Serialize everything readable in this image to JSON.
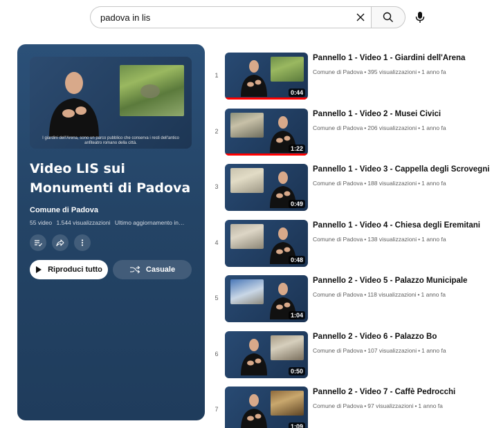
{
  "search": {
    "query": "padova in lis"
  },
  "icons": {
    "clear": "close-icon",
    "search": "search-icon",
    "mic": "microphone-icon",
    "save": "add-to-queue-icon",
    "share": "share-icon",
    "more": "more-vert-icon",
    "play": "play-icon",
    "shuffle": "shuffle-icon"
  },
  "colors": {
    "panel": "#244466",
    "progress": "#ff0000"
  },
  "playlist": {
    "thumb_caption": "I giardini dell'Arena, sono un parco pubblico che conserva i resti dell'antico anfiteatro romano della città.",
    "title": "Video LIS sui Monumenti di Padova",
    "channel": "Comune di Padova",
    "video_count": "55 video",
    "views": "1.544 visualizzazioni",
    "updated": "Ultimo aggiornamento in…",
    "play_all_label": "Riproduci tutto",
    "shuffle_label": "Casuale"
  },
  "videos": [
    {
      "index": "1",
      "title": "Pannello 1 - Video 1 - Giardini dell'Arena",
      "channel": "Comune di Padova",
      "views": "395 visualizzazioni",
      "age": "1 anno fa",
      "duration": "0:44",
      "watched": 1.0,
      "layout": "person-left"
    },
    {
      "index": "2",
      "title": "Pannello 1 - Video 2 - Musei Civici",
      "channel": "Comune di Padova",
      "views": "206 visualizzazioni",
      "age": "1 anno fa",
      "duration": "1:22",
      "watched": 1.0,
      "layout": "person-right"
    },
    {
      "index": "3",
      "title": "Pannello 1 - Video 3 - Cappella degli Scrovegni",
      "channel": "Comune di Padova",
      "views": "188 visualizzazioni",
      "age": "1 anno fa",
      "duration": "0:49",
      "watched": 0,
      "layout": "person-right"
    },
    {
      "index": "4",
      "title": "Pannello 1 - Video 4 - Chiesa degli Eremitani",
      "channel": "Comune di Padova",
      "views": "138 visualizzazioni",
      "age": "1 anno fa",
      "duration": "0:48",
      "watched": 0,
      "layout": "person-right"
    },
    {
      "index": "5",
      "title": "Pannello 2 - Video 5 - Palazzo Municipale",
      "channel": "Comune di Padova",
      "views": "118 visualizzazioni",
      "age": "1 anno fa",
      "duration": "1:04",
      "watched": 0,
      "layout": "person-right"
    },
    {
      "index": "6",
      "title": "Pannello 2 - Video 6 - Palazzo Bo",
      "channel": "Comune di Padova",
      "views": "107 visualizzazioni",
      "age": "1 anno fa",
      "duration": "0:50",
      "watched": 0,
      "layout": "person-left"
    },
    {
      "index": "7",
      "title": "Pannello 2 - Video 7 - Caffè Pedrocchi",
      "channel": "Comune di Padova",
      "views": "97 visualizzazioni",
      "age": "1 anno fa",
      "duration": "1:09",
      "watched": 0,
      "layout": "person-left"
    }
  ]
}
